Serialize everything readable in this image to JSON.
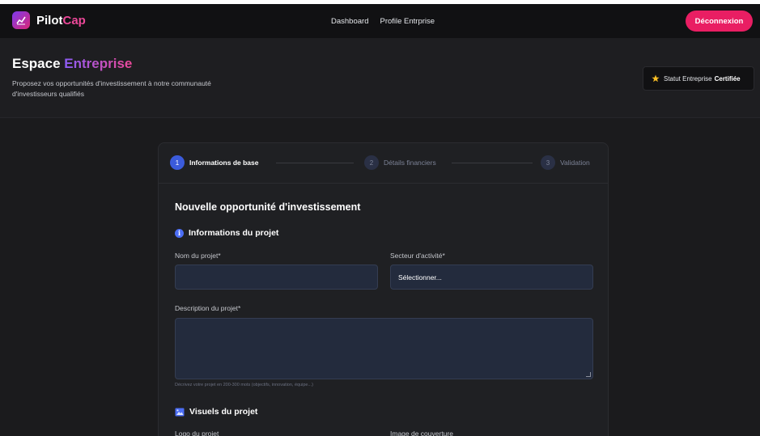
{
  "navbar": {
    "brand_main": "Pilot",
    "brand_accent": "Cap",
    "links": [
      "Dashboard",
      "Profile Entrprise"
    ],
    "logout_label": "Déconnexion"
  },
  "header": {
    "title_main": "Espace",
    "title_accent": "Entreprise",
    "subtitle": "Proposez vos opportunités d'investissement à notre communauté d'investisseurs qualifiés",
    "status_prefix": "Statut Entreprise",
    "status_value": "Certifiée"
  },
  "stepper": {
    "steps": [
      {
        "num": "1",
        "label": "Informations de base",
        "state": "active"
      },
      {
        "num": "2",
        "label": "Détails financiers",
        "state": "inactive"
      },
      {
        "num": "3",
        "label": "Validation",
        "state": "inactive"
      }
    ]
  },
  "form": {
    "title": "Nouvelle opportunité d'investissement",
    "section_project": "Informations du projet",
    "project_name_label": "Nom du projet*",
    "project_name_value": "",
    "sector_label": "Secteur d'activité*",
    "sector_selected": "Sélectionner...",
    "description_label": "Description du projet*",
    "description_value": "",
    "description_hint": "Décrivez votre projet en 200-300 mots (objectifs, innovation, équipe...)",
    "section_visuals": "Visuels du projet",
    "logo_label": "Logo du projet",
    "cover_label": "Image de couverture"
  },
  "colors": {
    "accent_pink": "#e91e63",
    "active_step": "#3b5bdb",
    "input_bg": "#232b3d"
  },
  "icons": {
    "brand": "chart-line-icon",
    "status": "star-icon",
    "section_project": "info-icon",
    "section_visuals": "image-icon"
  }
}
